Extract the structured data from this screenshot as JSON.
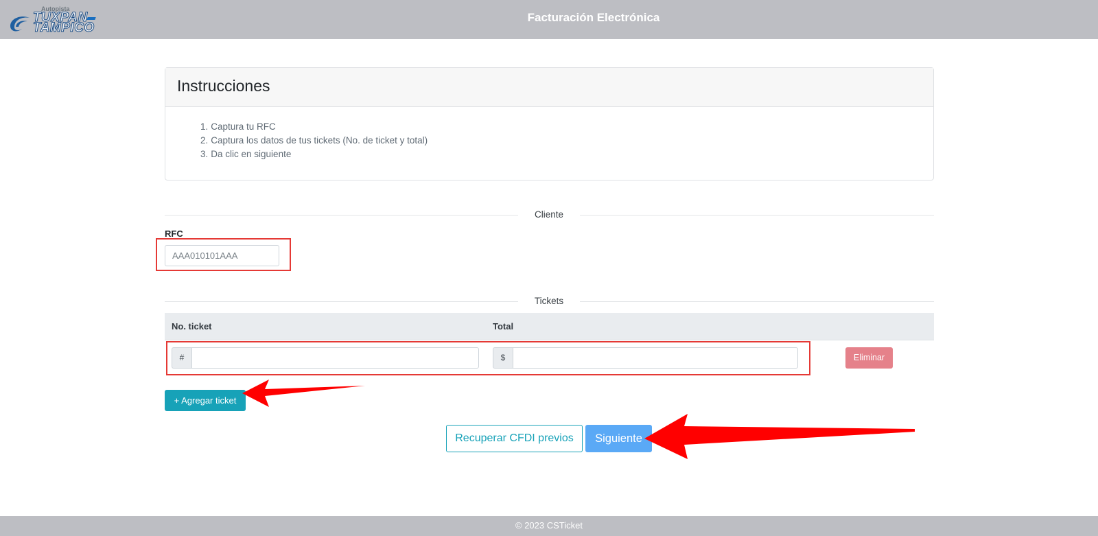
{
  "header": {
    "logo_small": "Autopista",
    "logo_line1": "TUXPAN",
    "logo_line2": "TAMPICO",
    "title": "Facturación Electrónica"
  },
  "instructions": {
    "title": "Instrucciones",
    "steps": [
      {
        "num": "1.",
        "text": "Captura tu RFC"
      },
      {
        "num": "2.",
        "text": "Captura los datos de tus tickets (No. de ticket y total)"
      },
      {
        "num": "3.",
        "text": "Da clic en siguiente"
      }
    ]
  },
  "cliente": {
    "section_label": "Cliente",
    "rfc_label": "RFC",
    "rfc_placeholder": "AAA010101AAA",
    "rfc_value": ""
  },
  "tickets": {
    "section_label": "Tickets",
    "col_ticket": "No. ticket",
    "col_total": "Total",
    "ticket_addon": "#",
    "total_addon": "$",
    "rows": [
      {
        "ticket_value": "",
        "total_value": "",
        "delete_label": "Eliminar"
      }
    ],
    "add_label": "+ Agregar ticket"
  },
  "actions": {
    "recover_label": "Recuperar CFDI previos",
    "next_label": "Siguiente"
  },
  "footer": {
    "text": "© 2023 CSTicket"
  },
  "colors": {
    "header_bg": "#bdbec3",
    "info": "#17a2b8",
    "primary": "#5aa9f6",
    "danger": "#e5818a",
    "annotation_red": "#e53935"
  }
}
